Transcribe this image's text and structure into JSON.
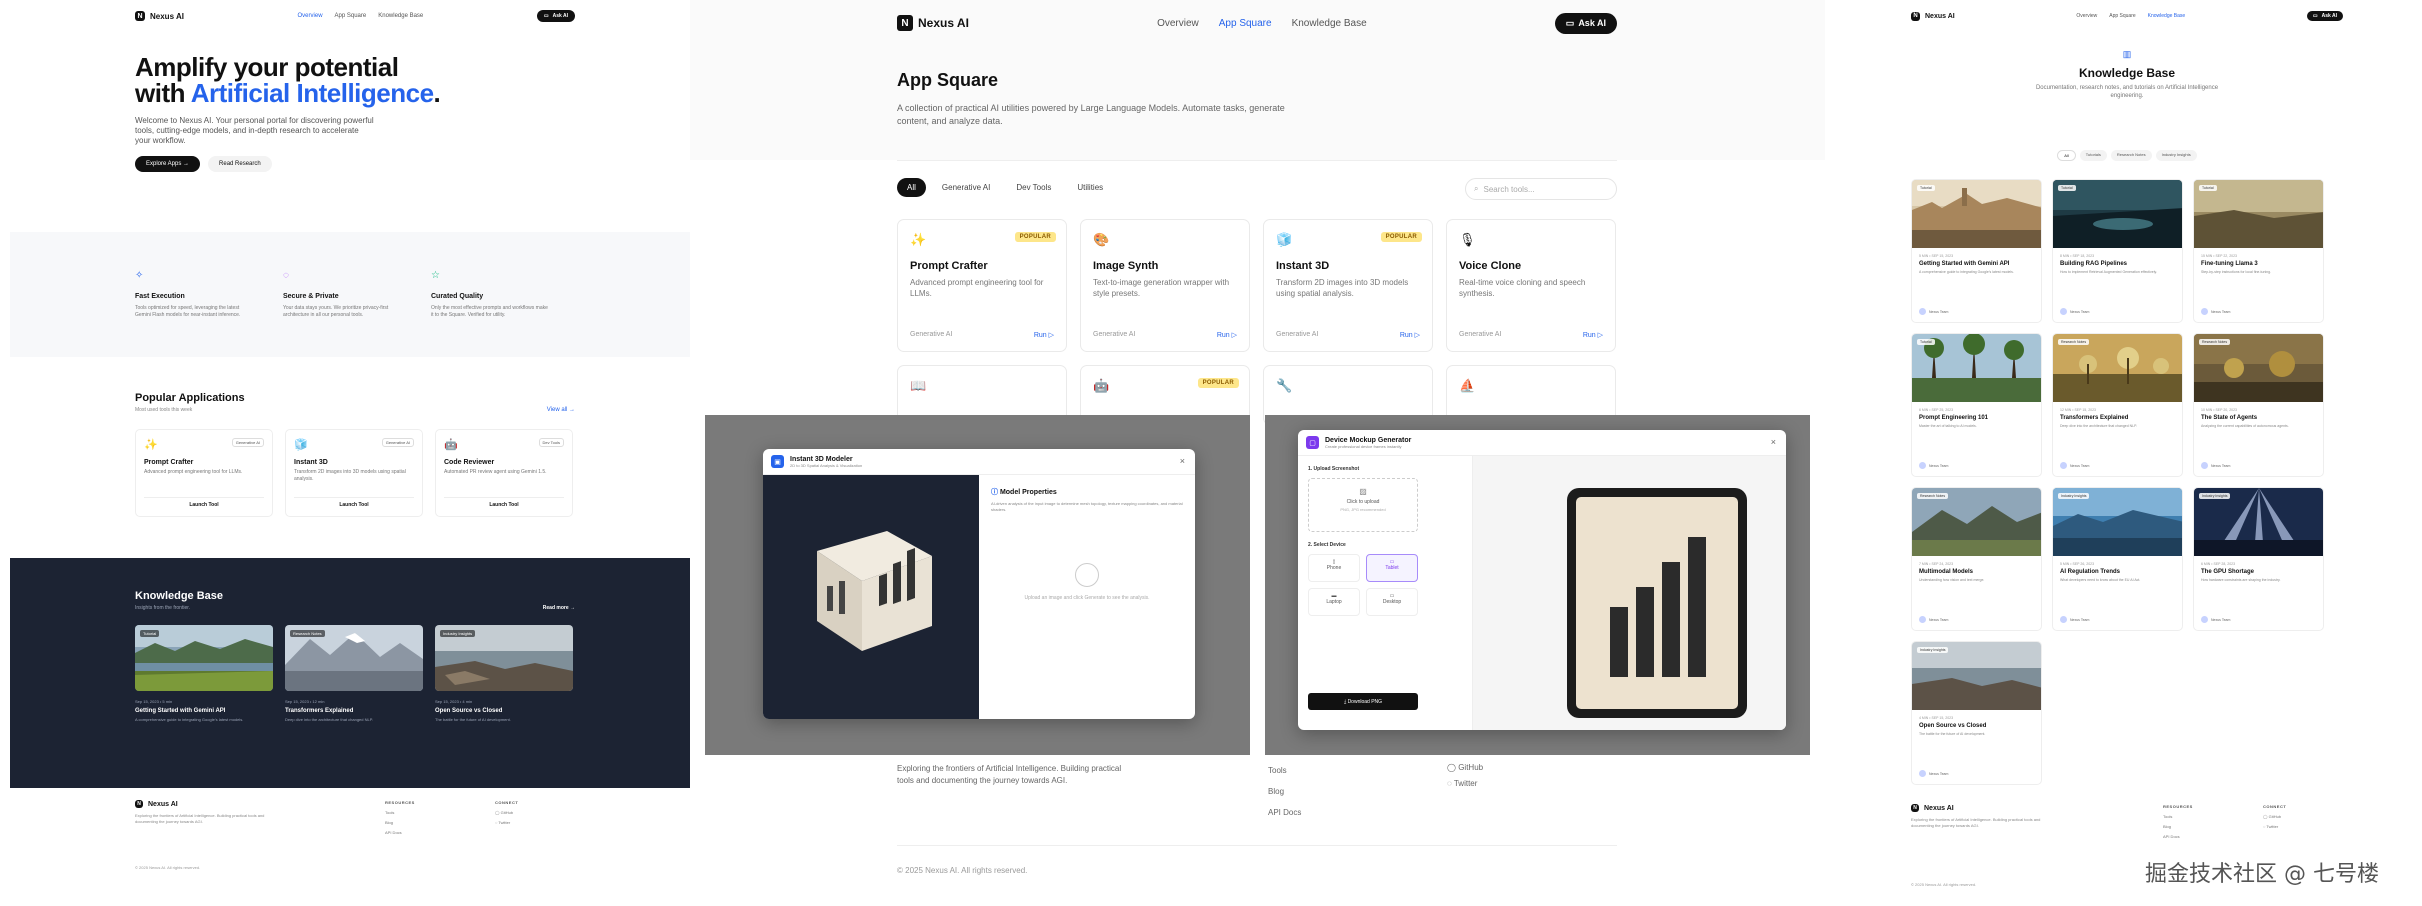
{
  "brand": {
    "name": "Nexus AI",
    "mark": "N"
  },
  "nav": {
    "items": [
      "Overview",
      "App Square",
      "Knowledge Base"
    ],
    "ask": "Ask AI"
  },
  "home": {
    "hero_line1": "Amplify your potential",
    "hero_line2_prefix": "with ",
    "hero_line2_accent": "Artificial Intelligence",
    "hero_line2_suffix": ".",
    "intro": "Welcome to Nexus AI. Your personal portal for discovering powerful tools, cutting-edge models, and in-depth research to accelerate your workflow.",
    "explore": "Explore Apps →",
    "research": "Read Research",
    "features": [
      {
        "icon": "lightning-icon",
        "glyph": "✧",
        "title": "Fast Execution",
        "desc": "Tools optimized for speed, leveraging the latest Gemini Flash models for near-instant inference."
      },
      {
        "icon": "shield-icon",
        "glyph": "◌",
        "title": "Secure & Private",
        "desc": "Your data stays yours. We prioritize privacy-first architecture in all our personal tools."
      },
      {
        "icon": "star-icon",
        "glyph": "☆",
        "title": "Curated Quality",
        "desc": "Only the most effective prompts and workflows make it to the Square. Verified for utility."
      }
    ],
    "popular": {
      "title": "Popular Applications",
      "sub": "Most used tools this week",
      "view_all": "View all →",
      "apps": [
        {
          "icon": "✨",
          "tag": "Generative AI",
          "name": "Prompt Crafter",
          "desc": "Advanced prompt engineering tool for LLMs.",
          "launch": "Launch Tool"
        },
        {
          "icon": "🧊",
          "tag": "Generative AI",
          "name": "Instant 3D",
          "desc": "Transform 2D images into 3D models using spatial analysis.",
          "launch": "Launch Tool"
        },
        {
          "icon": "🤖",
          "tag": "Dev Tools",
          "name": "Code Reviewer",
          "desc": "Automated PR review agent using Gemini 1.5.",
          "launch": "Launch Tool"
        }
      ]
    },
    "kb": {
      "title": "Knowledge Base",
      "sub": "Insights from the frontier.",
      "more": "Read more →",
      "posts": [
        {
          "tag": "Tutorial",
          "meta": "Sep 15, 2023   •   5 min",
          "title": "Getting Started with Gemini API",
          "desc": "A comprehensive guide to integrating Google's latest models."
        },
        {
          "tag": "Research Notes",
          "meta": "Sep 15, 2023   •   12 min",
          "title": "Transformers Explained",
          "desc": "Deep dive into the architecture that changed NLP."
        },
        {
          "tag": "Industry Insights",
          "meta": "Sep 15, 2023   •   4 min",
          "title": "Open Source vs Closed",
          "desc": "The battle for the future of AI development."
        }
      ]
    },
    "footer": {
      "tagline": "Exploring the frontiers of Artificial Intelligence. Building practical tools and documenting the journey towards AGI.",
      "resources_h": "RESOURCES",
      "resources": [
        "Tools",
        "Blog",
        "API Docs"
      ],
      "connect_h": "CONNECT",
      "connect": [
        "GitHub",
        "Twitter"
      ],
      "copy": "© 2025 Nexus AI. All rights reserved."
    }
  },
  "square": {
    "title": "App Square",
    "desc": "A collection of practical AI utilities powered by Large Language Models. Automate tasks, generate content, and analyze data.",
    "filters": [
      "All",
      "Generative AI",
      "Dev Tools",
      "Utilities"
    ],
    "search_placeholder": "Search tools...",
    "tools": [
      {
        "icon": "✨",
        "popular": "POPULAR",
        "name": "Prompt Crafter",
        "desc": "Advanced prompt engineering tool for LLMs.",
        "cat": "Generative AI",
        "run": "Run ▷"
      },
      {
        "icon": "🎨",
        "popular": "",
        "name": "Image Synth",
        "desc": "Text-to-image generation wrapper with style presets.",
        "cat": "Generative AI",
        "run": "Run ▷"
      },
      {
        "icon": "🧊",
        "popular": "POPULAR",
        "name": "Instant 3D",
        "desc": "Transform 2D images into 3D models using spatial analysis.",
        "cat": "Generative AI",
        "run": "Run ▷"
      },
      {
        "icon": "🎙",
        "popular": "",
        "name": "Voice Clone",
        "desc": "Real-time voice cloning and speech synthesis.",
        "cat": "Generative AI",
        "run": "Run ▷"
      }
    ],
    "tools_row2": [
      {
        "icon": "📖",
        "popular": ""
      },
      {
        "icon": "🤖",
        "popular": "POPULAR"
      },
      {
        "icon": "🔧",
        "popular": ""
      },
      {
        "icon": "⛵",
        "popular": ""
      }
    ],
    "footer_desc": "Exploring the frontiers of Artificial Intelligence. Building practical tools and documenting the journey towards AGI.",
    "footer_links": [
      "Tools",
      "Blog",
      "API Docs"
    ],
    "footer_connect": [
      "GitHub",
      "Twitter"
    ],
    "copy": "© 2025 Nexus AI. All rights reserved."
  },
  "modal_3d": {
    "title": "Instant 3D Modeler",
    "sub": "2D to 3D Spatial Analysis & Visualization",
    "prop_title": "Model Properties",
    "prop_desc": "AI-driven analysis of the input image to determine mesh topology, texture mapping coordinates, and material shaders.",
    "empty": "Upload an image and click Generate to see the analysis."
  },
  "modal_device": {
    "title": "Device Mockup Generator",
    "sub": "Create professional device frames instantly",
    "step1": "1. Upload Screenshot",
    "upload": "Click to upload",
    "upload_hint": "PNG, JPG recommended",
    "step2": "2. Select Device",
    "devices": [
      "Phone",
      "Tablet",
      "Laptop",
      "Desktop"
    ],
    "download": "⤓  Download PNG"
  },
  "kb_page": {
    "title": "Knowledge Base",
    "desc": "Documentation, research notes, and tutorials on Artificial Intelligence engineering.",
    "tabs": [
      "All",
      "Tutorials",
      "Research Notes",
      "Industry Insights"
    ],
    "articles": [
      {
        "tag": "Tutorial",
        "meta": "5 MIN  •  SEP 15, 2023",
        "title": "Getting Started with Gemini API",
        "desc": "A comprehensive guide to integrating Google's latest models.",
        "author": "Nexus Team"
      },
      {
        "tag": "Tutorial",
        "meta": "8 MIN  •  SEP 18, 2023",
        "title": "Building RAG Pipelines",
        "desc": "How to implement Retrieval Augmented Generation effectively.",
        "author": "Nexus Team"
      },
      {
        "tag": "Tutorial",
        "meta": "15 MIN  •  SEP 22, 2023",
        "title": "Fine-tuning Llama 3",
        "desc": "Step-by-step instructions for local fine-tuning.",
        "author": "Nexus Team"
      },
      {
        "tag": "Tutorial",
        "meta": "6 MIN  •  SEP 25, 2023",
        "title": "Prompt Engineering 101",
        "desc": "Master the art of talking to AI models.",
        "author": "Nexus Team"
      },
      {
        "tag": "Research Notes",
        "meta": "12 MIN  •  SEP 15, 2023",
        "title": "Transformers Explained",
        "desc": "Deep dive into the architecture that changed NLP.",
        "author": "Nexus Team"
      },
      {
        "tag": "Research Notes",
        "meta": "10 MIN  •  SEP 20, 2023",
        "title": "The State of Agents",
        "desc": "Analyzing the current capabilities of autonomous agents.",
        "author": "Nexus Team"
      },
      {
        "tag": "Research Notes",
        "meta": "7 MIN  •  SEP 24, 2023",
        "title": "Multimodal Models",
        "desc": "Understanding how vision and text merge.",
        "author": "Nexus Team"
      },
      {
        "tag": "Industry Insights",
        "meta": "5 MIN  •  SEP 26, 2023",
        "title": "AI Regulation Trends",
        "desc": "What developers need to know about the EU AI Act.",
        "author": "Nexus Team"
      },
      {
        "tag": "Industry Insights",
        "meta": "6 MIN  •  SEP 28, 2023",
        "title": "The GPU Shortage",
        "desc": "How hardware constraints are shaping the industry.",
        "author": "Nexus Team"
      },
      {
        "tag": "Industry Insights",
        "meta": "4 MIN  •  SEP 15, 2023",
        "title": "Open Source vs Closed",
        "desc": "The battle for the future of AI development.",
        "author": "Nexus Team"
      }
    ]
  },
  "watermark": "掘金技术社区 @ 七号楼",
  "colors": {
    "accent": "#2563eb",
    "dark": "#111111",
    "kb_bg": "#1c2333",
    "popular_bg": "#fde68a"
  }
}
